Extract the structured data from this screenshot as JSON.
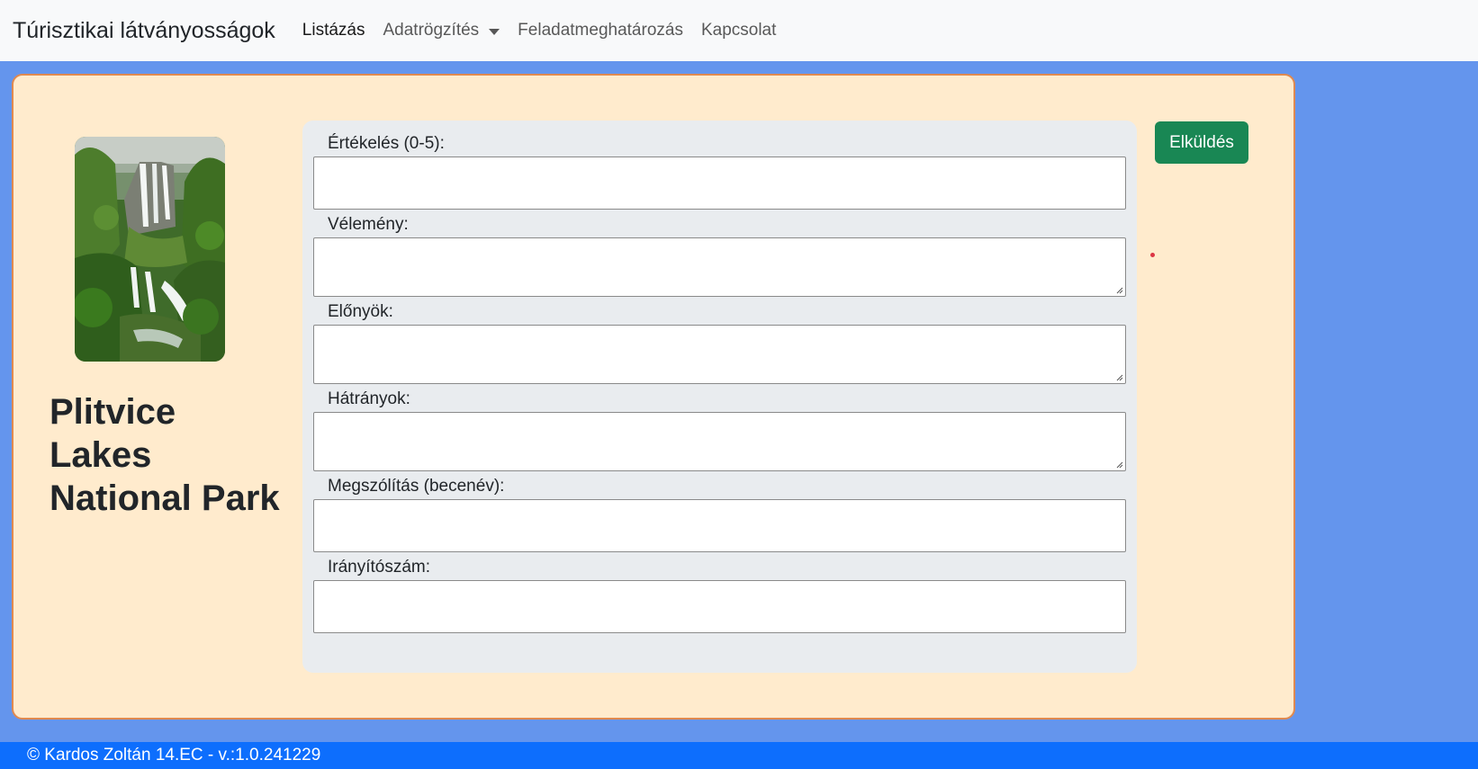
{
  "navbar": {
    "brand": "Túrisztikai látványosságok",
    "items": [
      {
        "label": "Listázás"
      },
      {
        "label": "Adatrögzítés"
      },
      {
        "label": "Feladatmeghatározás"
      },
      {
        "label": "Kapcsolat"
      }
    ]
  },
  "place": {
    "title_line1": "Plitvice Lakes",
    "title_line2": "National Park"
  },
  "form": {
    "fields": [
      {
        "label": "Értékelés (0-5):",
        "value": ""
      },
      {
        "label": "Vélemény:",
        "value": ""
      },
      {
        "label": "Előnyök:",
        "value": ""
      },
      {
        "label": "Hátrányok:",
        "value": ""
      },
      {
        "label": "Megszólítás (becenév):",
        "value": ""
      },
      {
        "label": "Irányítószám:",
        "value": ""
      }
    ],
    "submit_label": "Elküldés"
  },
  "footer": {
    "text": "© Kardos Zoltán 14.EC - v.:1.0.241229"
  },
  "colors": {
    "page_bg": "#6495ED",
    "card_bg": "#FFEBCD",
    "card_border": "#E0894F",
    "submit": "#198754",
    "footer": "#0D6EFD"
  }
}
